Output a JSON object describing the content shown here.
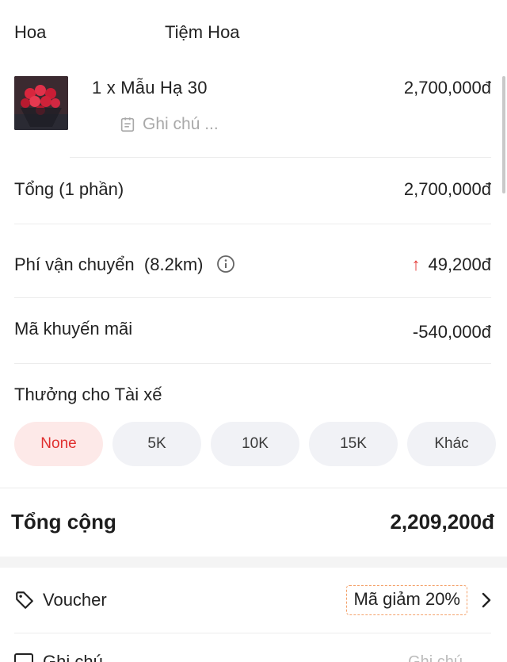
{
  "header": {
    "category": "Hoa",
    "shop_name": "Tiệm Hoa"
  },
  "item": {
    "name": "1 x Mẫu Hạ 30",
    "price": "2,700,000đ",
    "note_placeholder": "Ghi chú ...",
    "note_icon": "note-icon",
    "thumbnail": "red-rose-bouquet"
  },
  "subtotal": {
    "label": "Tổng (1 phần)",
    "value": "2,700,000đ"
  },
  "shipping": {
    "label": "Phí vận chuyển",
    "distance": "(8.2km)",
    "value": "49,200đ",
    "trend_icon": "arrow-up-icon",
    "trend_color": "#e53935"
  },
  "promo": {
    "label": "Mã khuyến mãi",
    "value": "-540,000đ"
  },
  "tip": {
    "label": "Thưởng cho Tài xế",
    "options": [
      "None",
      "5K",
      "10K",
      "15K",
      "Khác"
    ],
    "selected": "None",
    "accent": "#e0302f"
  },
  "total": {
    "label": "Tổng cộng",
    "value": "2,209,200đ"
  },
  "voucher": {
    "label": "Voucher",
    "badge": "Mã giảm 20%"
  },
  "next_row": {
    "label": "Ghi chú",
    "hint": "Ghi chú"
  }
}
